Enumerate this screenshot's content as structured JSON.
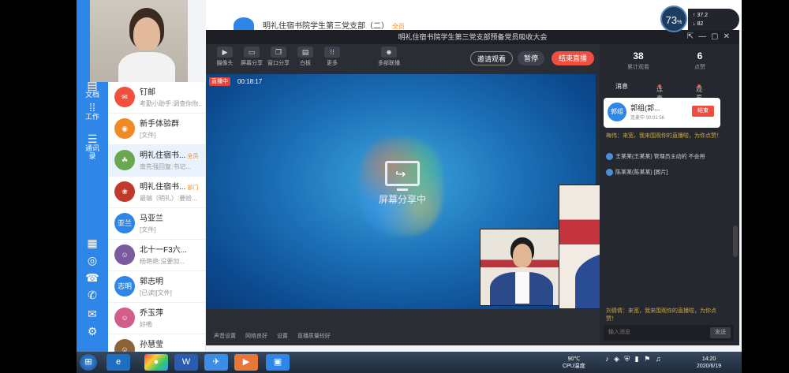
{
  "group_header": {
    "title": "明礼住宿书院学生第三党支部（二）",
    "tag": "全员"
  },
  "zoom": {
    "percent": "73",
    "unit": "%",
    "upload": "37.2",
    "download": "82"
  },
  "rail": {
    "items": [
      {
        "label": "文档",
        "icon": "document-icon"
      },
      {
        "label": "工作",
        "icon": "grid-icon"
      },
      {
        "label": "通讯录",
        "icon": "contacts-icon"
      }
    ]
  },
  "chats": [
    {
      "name": "钉邮",
      "sub": "考勤小助手:调查你你...",
      "color": "#f0503c",
      "glyph": "✉"
    },
    {
      "name": "新手体验群",
      "sub": "[文件]",
      "color": "#f08a24",
      "glyph": "◉"
    },
    {
      "name": "明礼住宿书...",
      "tag": "全员",
      "sub": "南先强回复:书记...",
      "color": "#6aa84f",
      "glyph": "☘"
    },
    {
      "name": "明礼住宿书...",
      "tag": "部门",
      "sub": "最端（明礼）:要给...",
      "color": "#c0392b",
      "glyph": "❀"
    },
    {
      "name": "马亚兰",
      "sub": "[文件]",
      "color": "#2e87e8",
      "glyph": "亚兰"
    },
    {
      "name": "北十一F3六...",
      "sub": "杨艳艳:没要加...",
      "color": "#7a5c9e",
      "glyph": "☺"
    },
    {
      "name": "郭志明",
      "sub": "[已读][文件]",
      "color": "#2e87e8",
      "glyph": "志明"
    },
    {
      "name": "乔玉萍",
      "sub": "好嘞",
      "color": "#d35d8a",
      "glyph": "☺"
    },
    {
      "name": "孙慧莹",
      "sub": "",
      "color": "#8c6239",
      "glyph": "☺"
    }
  ],
  "live": {
    "title": "明礼住宿书院学生第三党支部预备党员吸收大会",
    "toolbar": [
      {
        "label": "摄像头",
        "icon": "camera-icon"
      },
      {
        "label": "屏幕分享",
        "icon": "screen-icon"
      },
      {
        "label": "窗口分享",
        "icon": "window-icon"
      },
      {
        "label": "白板",
        "icon": "whiteboard-icon"
      },
      {
        "label": "更多",
        "icon": "more-icon"
      },
      {
        "label": "多部联播",
        "icon": "person-icon"
      }
    ],
    "invite": "邀请观看",
    "pause": "暂停",
    "end": "结束直播",
    "badge": "直播中",
    "timer": "00:18:17",
    "share_text": "屏幕分享中",
    "bottom": [
      "声音设置",
      "网络良好",
      "设置",
      "直播质量较好"
    ]
  },
  "stats": [
    {
      "value": "38",
      "label": "累计观看"
    },
    {
      "value": "6",
      "label": "点赞"
    }
  ],
  "tabs": [
    "消息",
    "连麦·1",
    "观看·38"
  ],
  "speaker": {
    "avatar": "郭组",
    "name": "郭组(郭...",
    "status": "连麦中 00:01:56",
    "button": "结束"
  },
  "messages": [
    {
      "text": "梅伟：来宽，我来围观你的直播啦，为你点赞！",
      "style": "y"
    },
    {
      "text": "王某某(王某某)   管理员主动的   不会用",
      "style": "w"
    },
    {
      "text": "陈某某(陈某某)    [图片]",
      "style": "w"
    },
    {
      "text": "刘倩倩：来宽，我来围观你的直播啦，为你点赞！",
      "style": "y"
    }
  ],
  "input_placeholder": "输入消息",
  "send": "发送",
  "taskbar": {
    "temp": "90℃",
    "temp_label": "CPU温度",
    "time": "14:20",
    "date": "2020/6/19"
  }
}
